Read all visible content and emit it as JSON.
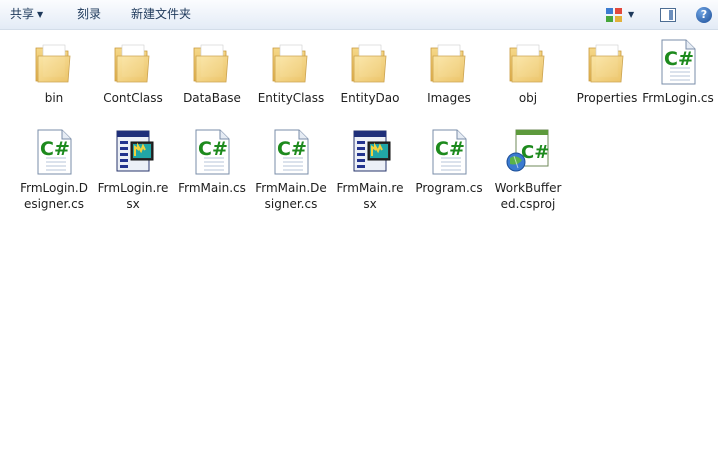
{
  "toolbar": {
    "share_label": "共享",
    "burn_label": "刻录",
    "new_folder_label": "新建文件夹"
  },
  "toolbar_right": {
    "view_icon": "view-options-icon",
    "pane_icon": "preview-pane-icon",
    "help_icon": "help-icon",
    "help_glyph": "?"
  },
  "items": [
    {
      "label": "bin",
      "kind": "folder"
    },
    {
      "label": "ContClass",
      "kind": "folder"
    },
    {
      "label": "DataBase",
      "kind": "folder"
    },
    {
      "label": "EntityClass",
      "kind": "folder"
    },
    {
      "label": "EntityDao",
      "kind": "folder"
    },
    {
      "label": "Images",
      "kind": "folder"
    },
    {
      "label": "obj",
      "kind": "folder"
    },
    {
      "label": "Properties",
      "kind": "folder"
    },
    {
      "label": "FrmLogin.cs",
      "kind": "cs"
    },
    {
      "label": "FrmLogin.Designer.cs",
      "kind": "cs"
    },
    {
      "label": "FrmLogin.resx",
      "kind": "resx"
    },
    {
      "label": "FrmMain.cs",
      "kind": "cs"
    },
    {
      "label": "FrmMain.Designer.cs",
      "kind": "cs"
    },
    {
      "label": "FrmMain.resx",
      "kind": "resx"
    },
    {
      "label": "Program.cs",
      "kind": "cs"
    },
    {
      "label": "WorkBuffered.csproj",
      "kind": "csproj"
    }
  ]
}
